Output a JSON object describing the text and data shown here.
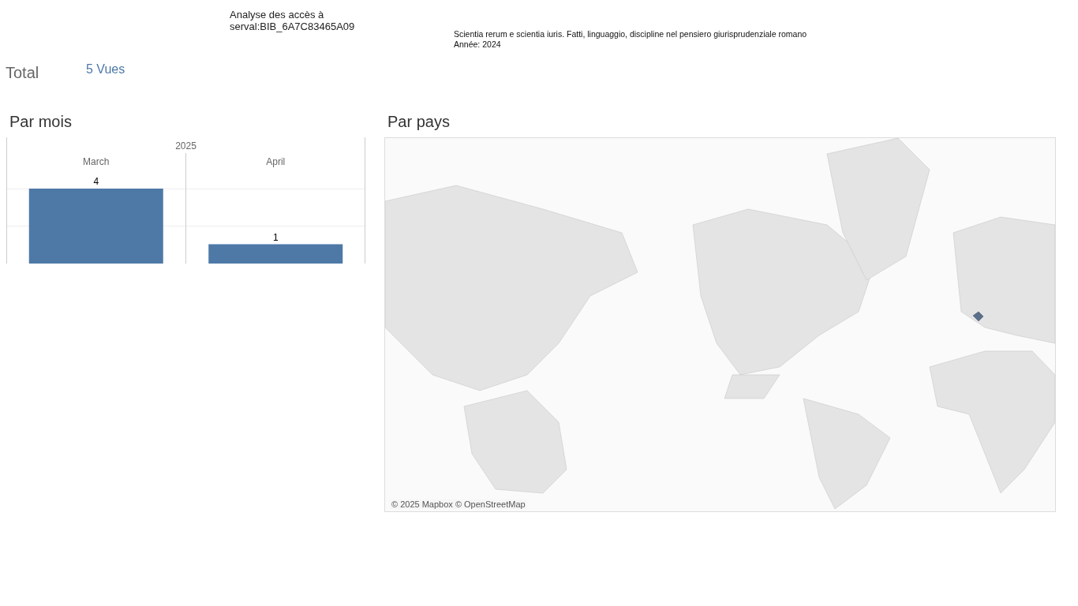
{
  "header": {
    "title_lines": [
      "Analyse des accès à",
      "serval:BIB_6A7C83465A09"
    ],
    "work_title": "Scientia rerum e scientia iuris. Fatti, linguaggio, discipline nel pensiero giurisprudenziale romano",
    "year_line": "Année: 2024"
  },
  "total": {
    "label": "Total",
    "value": "5 Vues"
  },
  "by_month": {
    "title": "Par mois",
    "year": "2025",
    "chart_data": {
      "type": "bar",
      "categories": [
        "March",
        "April"
      ],
      "values": [
        4,
        1
      ],
      "data_labels": true
    }
  },
  "by_country": {
    "title": "Par pays",
    "attribution": "© 2025 Mapbox © OpenStreetMap"
  }
}
